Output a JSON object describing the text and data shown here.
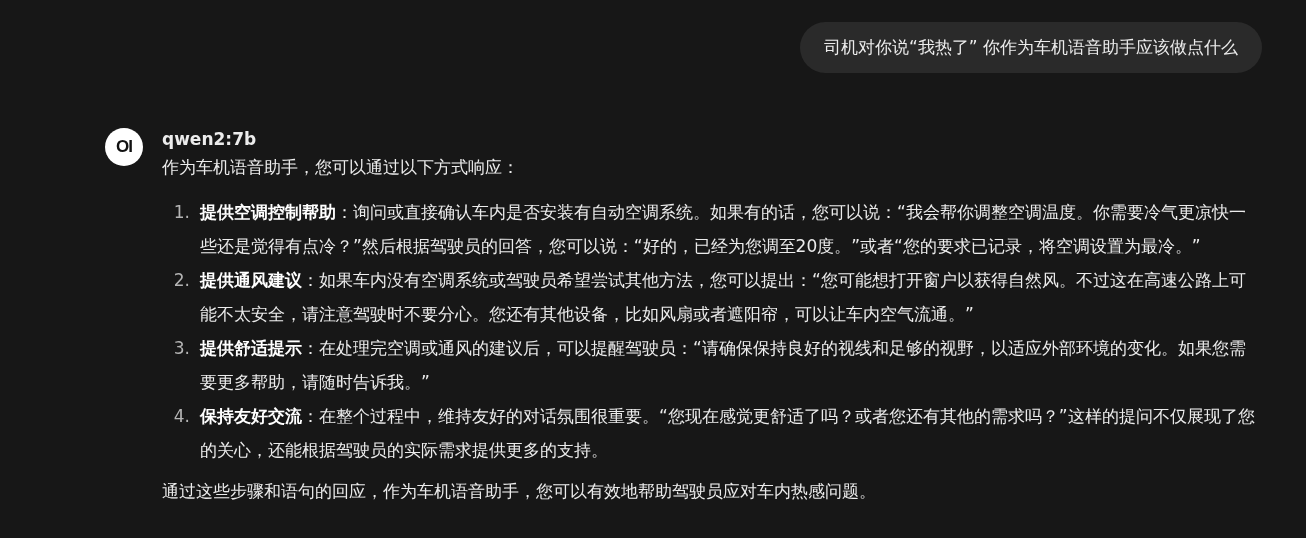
{
  "user_message": "司机对你说“我热了” 你作为车机语音助手应该做点什么",
  "assistant": {
    "avatar": "OI",
    "model": "qwen2:7b",
    "intro": "作为车机语音助手，您可以通过以下方式响应：",
    "items": [
      {
        "number": "1.",
        "text": "**提供空调控制帮助**：询问或直接确认车内是否安装有自动空调系统。如果有的话，您可以说：“我会帮你调整空调温度。你需要冷气更凉快一些还是觉得有点冷？”然后根据驾驶员的回答，您可以说：“好的，已经为您调至20度。”或者“您的要求已记录，将空调设置为最冷。”"
      },
      {
        "number": "2.",
        "text": "**提供通风建议**：如果车内没有空调系统或驾驶员希望尝试其他方法，您可以提出：“您可能想打开窗户以获得自然风。不过这在高速公路上可能不太安全，请注意驾驶时不要分心。您还有其他设备，比如风扇或者遮阳帘，可以让车内空气流通。”"
      },
      {
        "number": "3.",
        "text": "**提供舒适提示**：在处理完空调或通风的建议后，可以提醒驾驶员：“请确保保持良好的视线和足够的视野，以适应外部环境的变化。如果您需要更多帮助，请随时告诉我。”"
      },
      {
        "number": "4.",
        "text": "**保持友好交流**：在整个过程中，维持友好的对话氛围很重要。“您现在感觉更舒适了吗？或者您还有其他的需求吗？”这样的提问不仅展现了您的关心，还能根据驾驶员的实际需求提供更多的支持。"
      }
    ],
    "conclusion": "通过这些步骤和语句的回应，作为车机语音助手，您可以有效地帮助驾驶员应对车内热感问题。"
  }
}
